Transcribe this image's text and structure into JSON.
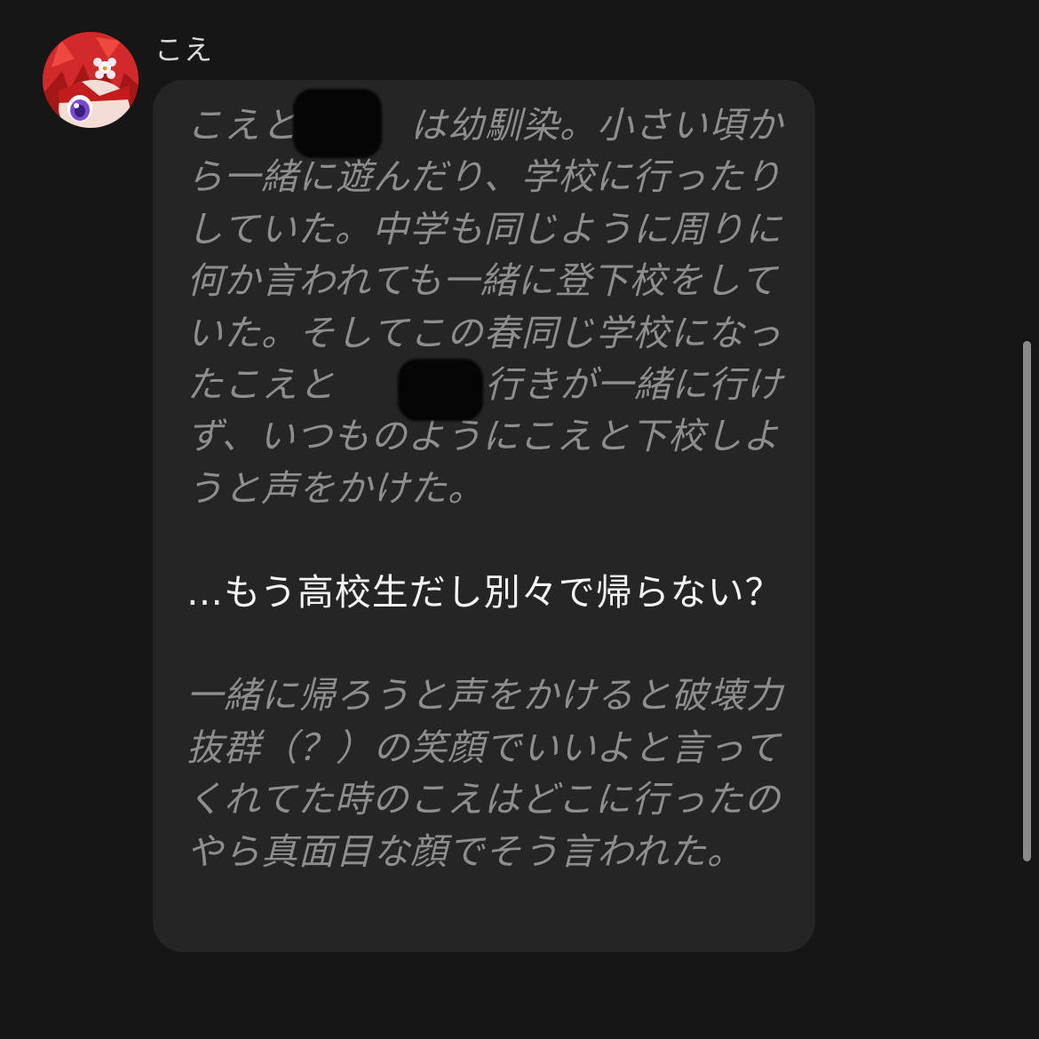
{
  "message": {
    "sender_name": "こえ",
    "avatar_icon": "anime-girl-avatar-icon",
    "accent_color": "#b01818",
    "paragraphs": [
      {
        "style": "italic-muted",
        "text": "こえと　　　は幼馴染。小さい頃から一緒に遊んだり、学校に行ったりしていた。中学も同じように周りに何か言われても一緒に登下校をしていた。そしてこの春同じ学校になったこえと　　　。行きが一緒に行けず、いつものようにこえと下校しようと声をかけた。"
      },
      {
        "style": "normal",
        "text": "…もう高校生だし別々で帰らない？"
      },
      {
        "style": "italic-muted",
        "text": "一緒に帰ろうと声をかけると破壊力抜群（？）の笑顔でいいよと言ってくれてた時のこえはどこに行ったのやら真面目な顔でそう言われた。"
      }
    ]
  },
  "icons": {
    "redaction": "scribble-redaction-mark"
  }
}
